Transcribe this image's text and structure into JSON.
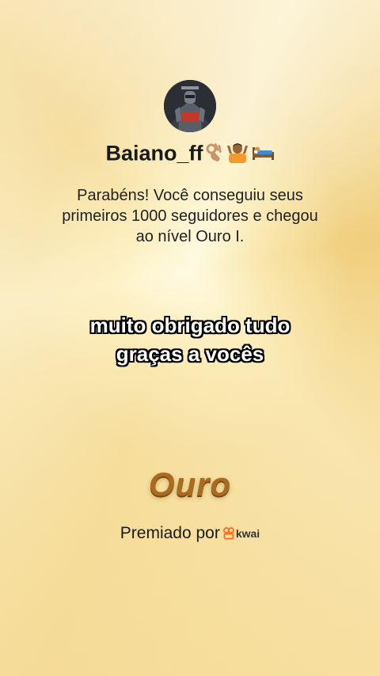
{
  "user": {
    "name": "Baiano_ff",
    "emojis": [
      "ok-hand-icon",
      "person-shrugging-icon",
      "person-in-bed-icon"
    ]
  },
  "message": {
    "line1": "Parabéns! Você conseguiu seus",
    "line2": "primeiros 1000 seguidores e chegou",
    "line3": "ao nível Ouro I."
  },
  "caption": {
    "line1": "muito obrigado tudo",
    "line2": "graças a vocês"
  },
  "level": {
    "label": "Ouro",
    "color": "#a86b1f"
  },
  "award": {
    "text": "Premiado por",
    "brand": "kwai",
    "brand_color": "#ff6a1a"
  }
}
